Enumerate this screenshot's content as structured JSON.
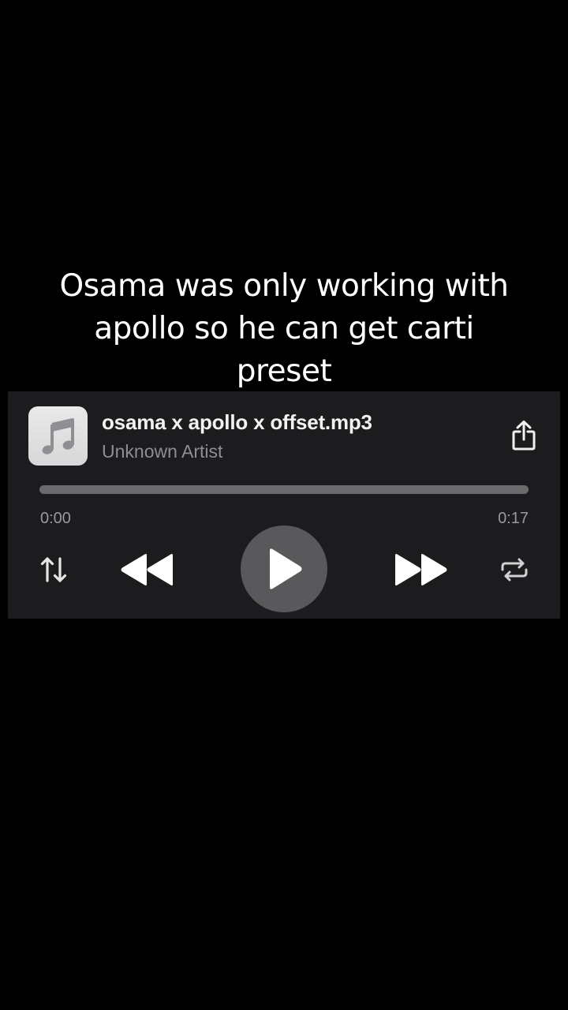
{
  "caption": {
    "line1": "Osama was only working with",
    "line2": "apollo so he can get carti",
    "line3": "preset"
  },
  "player": {
    "artwork_icon": "music-note-icon",
    "title": "osama x apollo x offset.mp3",
    "artist": "Unknown Artist",
    "share_icon": "share-icon",
    "progress_fraction": 0.0,
    "elapsed": "0:00",
    "duration": "0:17",
    "controls": {
      "shuffle_icon": "shuffle-icon",
      "rewind_icon": "rewind-icon",
      "play_icon": "play-icon",
      "forward_icon": "fast-forward-icon",
      "repeat_icon": "repeat-icon"
    }
  },
  "colors": {
    "background": "#000000",
    "player_background": "#1c1c1e",
    "secondary_text": "#8e8e93",
    "progress_track": "#6b6b6e",
    "play_button": "#59595c"
  }
}
